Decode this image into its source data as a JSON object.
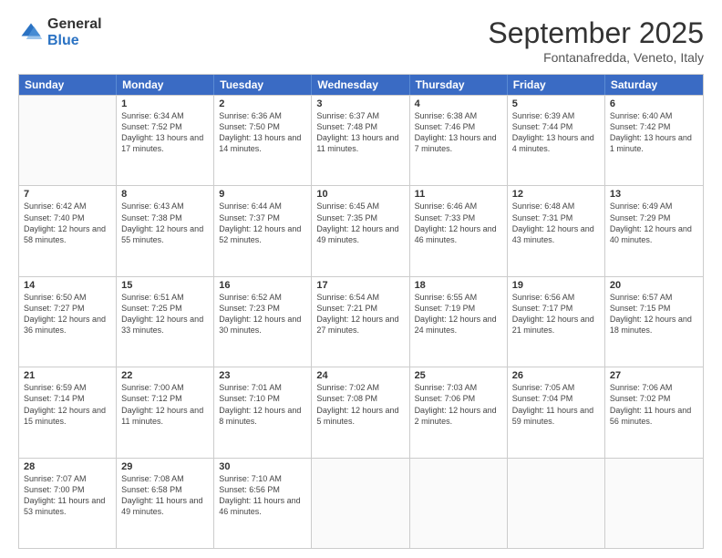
{
  "logo": {
    "general": "General",
    "blue": "Blue"
  },
  "title": "September 2025",
  "subtitle": "Fontanafredda, Veneto, Italy",
  "days": [
    "Sunday",
    "Monday",
    "Tuesday",
    "Wednesday",
    "Thursday",
    "Friday",
    "Saturday"
  ],
  "weeks": [
    [
      {
        "day": "",
        "empty": true
      },
      {
        "day": "1",
        "sunrise": "6:34 AM",
        "sunset": "7:52 PM",
        "daylight": "13 hours and 17 minutes."
      },
      {
        "day": "2",
        "sunrise": "6:36 AM",
        "sunset": "7:50 PM",
        "daylight": "13 hours and 14 minutes."
      },
      {
        "day": "3",
        "sunrise": "6:37 AM",
        "sunset": "7:48 PM",
        "daylight": "13 hours and 11 minutes."
      },
      {
        "day": "4",
        "sunrise": "6:38 AM",
        "sunset": "7:46 PM",
        "daylight": "13 hours and 7 minutes."
      },
      {
        "day": "5",
        "sunrise": "6:39 AM",
        "sunset": "7:44 PM",
        "daylight": "13 hours and 4 minutes."
      },
      {
        "day": "6",
        "sunrise": "6:40 AM",
        "sunset": "7:42 PM",
        "daylight": "13 hours and 1 minute."
      }
    ],
    [
      {
        "day": "7",
        "sunrise": "6:42 AM",
        "sunset": "7:40 PM",
        "daylight": "12 hours and 58 minutes."
      },
      {
        "day": "8",
        "sunrise": "6:43 AM",
        "sunset": "7:38 PM",
        "daylight": "12 hours and 55 minutes."
      },
      {
        "day": "9",
        "sunrise": "6:44 AM",
        "sunset": "7:37 PM",
        "daylight": "12 hours and 52 minutes."
      },
      {
        "day": "10",
        "sunrise": "6:45 AM",
        "sunset": "7:35 PM",
        "daylight": "12 hours and 49 minutes."
      },
      {
        "day": "11",
        "sunrise": "6:46 AM",
        "sunset": "7:33 PM",
        "daylight": "12 hours and 46 minutes."
      },
      {
        "day": "12",
        "sunrise": "6:48 AM",
        "sunset": "7:31 PM",
        "daylight": "12 hours and 43 minutes."
      },
      {
        "day": "13",
        "sunrise": "6:49 AM",
        "sunset": "7:29 PM",
        "daylight": "12 hours and 40 minutes."
      }
    ],
    [
      {
        "day": "14",
        "sunrise": "6:50 AM",
        "sunset": "7:27 PM",
        "daylight": "12 hours and 36 minutes."
      },
      {
        "day": "15",
        "sunrise": "6:51 AM",
        "sunset": "7:25 PM",
        "daylight": "12 hours and 33 minutes."
      },
      {
        "day": "16",
        "sunrise": "6:52 AM",
        "sunset": "7:23 PM",
        "daylight": "12 hours and 30 minutes."
      },
      {
        "day": "17",
        "sunrise": "6:54 AM",
        "sunset": "7:21 PM",
        "daylight": "12 hours and 27 minutes."
      },
      {
        "day": "18",
        "sunrise": "6:55 AM",
        "sunset": "7:19 PM",
        "daylight": "12 hours and 24 minutes."
      },
      {
        "day": "19",
        "sunrise": "6:56 AM",
        "sunset": "7:17 PM",
        "daylight": "12 hours and 21 minutes."
      },
      {
        "day": "20",
        "sunrise": "6:57 AM",
        "sunset": "7:15 PM",
        "daylight": "12 hours and 18 minutes."
      }
    ],
    [
      {
        "day": "21",
        "sunrise": "6:59 AM",
        "sunset": "7:14 PM",
        "daylight": "12 hours and 15 minutes."
      },
      {
        "day": "22",
        "sunrise": "7:00 AM",
        "sunset": "7:12 PM",
        "daylight": "12 hours and 11 minutes."
      },
      {
        "day": "23",
        "sunrise": "7:01 AM",
        "sunset": "7:10 PM",
        "daylight": "12 hours and 8 minutes."
      },
      {
        "day": "24",
        "sunrise": "7:02 AM",
        "sunset": "7:08 PM",
        "daylight": "12 hours and 5 minutes."
      },
      {
        "day": "25",
        "sunrise": "7:03 AM",
        "sunset": "7:06 PM",
        "daylight": "12 hours and 2 minutes."
      },
      {
        "day": "26",
        "sunrise": "7:05 AM",
        "sunset": "7:04 PM",
        "daylight": "11 hours and 59 minutes."
      },
      {
        "day": "27",
        "sunrise": "7:06 AM",
        "sunset": "7:02 PM",
        "daylight": "11 hours and 56 minutes."
      }
    ],
    [
      {
        "day": "28",
        "sunrise": "7:07 AM",
        "sunset": "7:00 PM",
        "daylight": "11 hours and 53 minutes."
      },
      {
        "day": "29",
        "sunrise": "7:08 AM",
        "sunset": "6:58 PM",
        "daylight": "11 hours and 49 minutes."
      },
      {
        "day": "30",
        "sunrise": "7:10 AM",
        "sunset": "6:56 PM",
        "daylight": "11 hours and 46 minutes."
      },
      {
        "day": "",
        "empty": true
      },
      {
        "day": "",
        "empty": true
      },
      {
        "day": "",
        "empty": true
      },
      {
        "day": "",
        "empty": true
      }
    ]
  ],
  "labels": {
    "sunrise": "Sunrise:",
    "sunset": "Sunset:",
    "daylight": "Daylight:"
  }
}
